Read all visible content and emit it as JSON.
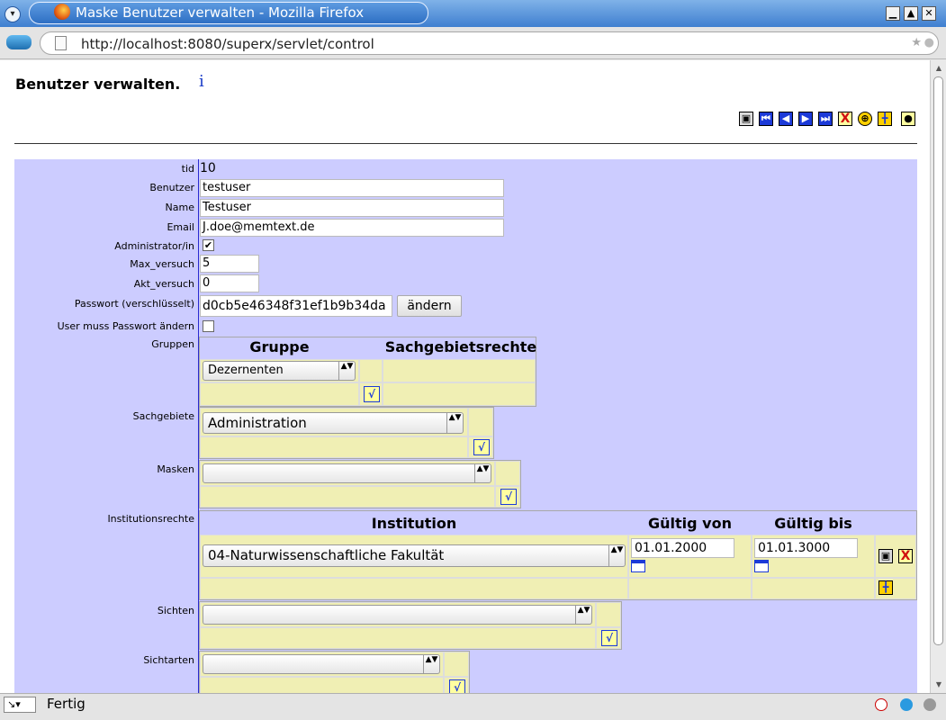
{
  "window": {
    "title": "Maske Benutzer verwalten - Mozilla Firefox",
    "menu_glyph": "▾",
    "buttons": [
      "▁",
      "▲",
      "✕"
    ]
  },
  "urlbar": {
    "url": "http://localhost:8080/superx/servlet/control",
    "star": "★",
    "go": "●"
  },
  "page": {
    "heading": "Benutzer verwalten.",
    "info": "i",
    "toolbar_icons": [
      "save-icon",
      "first-icon",
      "prev-icon",
      "next-icon",
      "last-icon",
      "delete-icon",
      "new-record-icon",
      "add-icon",
      "options-icon"
    ]
  },
  "form": {
    "labels": {
      "tid": "tid",
      "benutzer": "Benutzer",
      "name": "Name",
      "email": "Email",
      "admin": "Administrator/in",
      "max": "Max_versuch",
      "akt": "Akt_versuch",
      "passwort": "Passwort (verschlüsselt)",
      "muss": "User muss Passwort ändern",
      "gruppen": "Gruppen",
      "sachgebiete": "Sachgebiete",
      "masken": "Masken",
      "institutionsrechte": "Institutionsrechte",
      "sichten": "Sichten",
      "sichtarten": "Sichtarten"
    },
    "values": {
      "tid": "10",
      "benutzer": "testuser",
      "name": "Testuser",
      "email": "J.doe@memtext.de",
      "admin_checked": "✔",
      "max": "5",
      "akt": "0",
      "passwort": "d0cb5e46348f31ef1b9b34da",
      "muss_checked": ""
    },
    "change_button": "ändern",
    "gruppen": {
      "col1": "Gruppe",
      "col2": "Sachgebietsrechte",
      "selected": "Dezernenten"
    },
    "sachgebiete": {
      "selected": "Administration"
    },
    "masken": {
      "selected": ""
    },
    "institutionsrechte": {
      "col1": "Institution",
      "col2": "Gültig von",
      "col3": "Gültig bis",
      "selected": "04-Naturwissenschaftliche Fakultät",
      "von": "01.01.2000",
      "bis": "01.01.3000"
    },
    "sichten": {
      "selected": ""
    },
    "sichtarten": {
      "selected": ""
    },
    "ok_glyph": "√",
    "sel_arrows": "▲▼"
  },
  "statusbar": {
    "text": "Fertig",
    "tool": "↘▾"
  }
}
